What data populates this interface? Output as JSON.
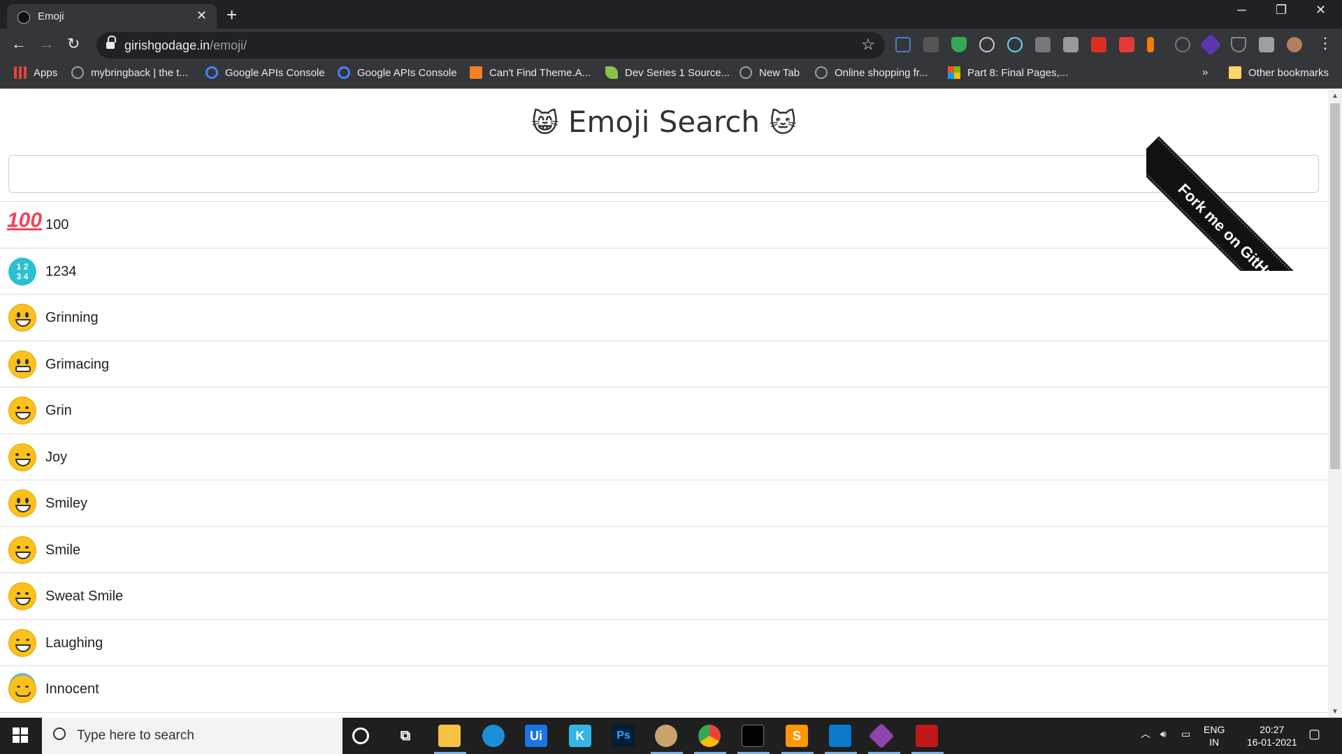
{
  "browser": {
    "tab_title": "Emoji",
    "new_tab": "+",
    "url_host": "girishgodage.in",
    "url_path": "/emoji/",
    "window_controls": [
      "─",
      "❐",
      "✕"
    ]
  },
  "bookmarks": [
    {
      "label": "Apps",
      "icon": "apps-grid-icon",
      "color": "#ea4335"
    },
    {
      "label": "mybringback | the t...",
      "icon": "globe-icon",
      "color": "#9aa0a6"
    },
    {
      "label": "Google APIs Console",
      "icon": "google-icon",
      "color": "#4285f4"
    },
    {
      "label": "Google APIs Console",
      "icon": "google-icon",
      "color": "#4285f4"
    },
    {
      "label": "Can't Find Theme.A...",
      "icon": "stackoverflow-icon",
      "color": "#f48024"
    },
    {
      "label": "Dev Series 1 Source...",
      "icon": "rocket-icon",
      "color": "#8bc34a"
    },
    {
      "label": "New Tab",
      "icon": "globe-icon",
      "color": "#9aa0a6"
    },
    {
      "label": "Online shopping fr...",
      "icon": "globe-icon",
      "color": "#9aa0a6"
    },
    {
      "label": "Part 8: Final Pages,...",
      "icon": "microsoft-icon",
      "color": "#f25022"
    }
  ],
  "bookmarks_more": "»",
  "other_bookmarks": "Other bookmarks",
  "page": {
    "title": "Emoji Search",
    "title_left_emoji": "😸",
    "title_right_emoji": "🐱",
    "search_value": "",
    "ribbon": "Fork me on GitHub"
  },
  "emojis": [
    {
      "symbol": "💯",
      "label": "100"
    },
    {
      "symbol": "🔢",
      "label": "1234"
    },
    {
      "symbol": "😀",
      "label": "Grinning"
    },
    {
      "symbol": "😬",
      "label": "Grimacing"
    },
    {
      "symbol": "😁",
      "label": "Grin"
    },
    {
      "symbol": "😂",
      "label": "Joy"
    },
    {
      "symbol": "😃",
      "label": "Smiley"
    },
    {
      "symbol": "😄",
      "label": "Smile"
    },
    {
      "symbol": "😅",
      "label": "Sweat Smile"
    },
    {
      "symbol": "😆",
      "label": "Laughing"
    },
    {
      "symbol": "😇",
      "label": "Innocent"
    }
  ],
  "taskbar": {
    "search_placeholder": "Type here to search",
    "lang_top": "ENG",
    "lang_bottom": "IN",
    "time": "20:27",
    "date": "16-01-2021"
  }
}
